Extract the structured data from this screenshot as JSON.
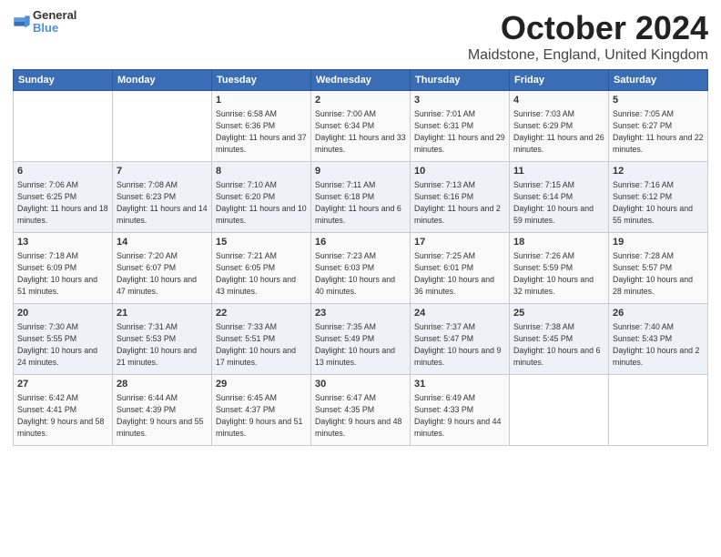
{
  "logo": {
    "line1": "General",
    "line2": "Blue"
  },
  "title": "October 2024",
  "subtitle": "Maidstone, England, United Kingdom",
  "days_of_week": [
    "Sunday",
    "Monday",
    "Tuesday",
    "Wednesday",
    "Thursday",
    "Friday",
    "Saturday"
  ],
  "weeks": [
    [
      {
        "day": "",
        "info": ""
      },
      {
        "day": "",
        "info": ""
      },
      {
        "day": "1",
        "info": "Sunrise: 6:58 AM\nSunset: 6:36 PM\nDaylight: 11 hours and 37 minutes."
      },
      {
        "day": "2",
        "info": "Sunrise: 7:00 AM\nSunset: 6:34 PM\nDaylight: 11 hours and 33 minutes."
      },
      {
        "day": "3",
        "info": "Sunrise: 7:01 AM\nSunset: 6:31 PM\nDaylight: 11 hours and 29 minutes."
      },
      {
        "day": "4",
        "info": "Sunrise: 7:03 AM\nSunset: 6:29 PM\nDaylight: 11 hours and 26 minutes."
      },
      {
        "day": "5",
        "info": "Sunrise: 7:05 AM\nSunset: 6:27 PM\nDaylight: 11 hours and 22 minutes."
      }
    ],
    [
      {
        "day": "6",
        "info": "Sunrise: 7:06 AM\nSunset: 6:25 PM\nDaylight: 11 hours and 18 minutes."
      },
      {
        "day": "7",
        "info": "Sunrise: 7:08 AM\nSunset: 6:23 PM\nDaylight: 11 hours and 14 minutes."
      },
      {
        "day": "8",
        "info": "Sunrise: 7:10 AM\nSunset: 6:20 PM\nDaylight: 11 hours and 10 minutes."
      },
      {
        "day": "9",
        "info": "Sunrise: 7:11 AM\nSunset: 6:18 PM\nDaylight: 11 hours and 6 minutes."
      },
      {
        "day": "10",
        "info": "Sunrise: 7:13 AM\nSunset: 6:16 PM\nDaylight: 11 hours and 2 minutes."
      },
      {
        "day": "11",
        "info": "Sunrise: 7:15 AM\nSunset: 6:14 PM\nDaylight: 10 hours and 59 minutes."
      },
      {
        "day": "12",
        "info": "Sunrise: 7:16 AM\nSunset: 6:12 PM\nDaylight: 10 hours and 55 minutes."
      }
    ],
    [
      {
        "day": "13",
        "info": "Sunrise: 7:18 AM\nSunset: 6:09 PM\nDaylight: 10 hours and 51 minutes."
      },
      {
        "day": "14",
        "info": "Sunrise: 7:20 AM\nSunset: 6:07 PM\nDaylight: 10 hours and 47 minutes."
      },
      {
        "day": "15",
        "info": "Sunrise: 7:21 AM\nSunset: 6:05 PM\nDaylight: 10 hours and 43 minutes."
      },
      {
        "day": "16",
        "info": "Sunrise: 7:23 AM\nSunset: 6:03 PM\nDaylight: 10 hours and 40 minutes."
      },
      {
        "day": "17",
        "info": "Sunrise: 7:25 AM\nSunset: 6:01 PM\nDaylight: 10 hours and 36 minutes."
      },
      {
        "day": "18",
        "info": "Sunrise: 7:26 AM\nSunset: 5:59 PM\nDaylight: 10 hours and 32 minutes."
      },
      {
        "day": "19",
        "info": "Sunrise: 7:28 AM\nSunset: 5:57 PM\nDaylight: 10 hours and 28 minutes."
      }
    ],
    [
      {
        "day": "20",
        "info": "Sunrise: 7:30 AM\nSunset: 5:55 PM\nDaylight: 10 hours and 24 minutes."
      },
      {
        "day": "21",
        "info": "Sunrise: 7:31 AM\nSunset: 5:53 PM\nDaylight: 10 hours and 21 minutes."
      },
      {
        "day": "22",
        "info": "Sunrise: 7:33 AM\nSunset: 5:51 PM\nDaylight: 10 hours and 17 minutes."
      },
      {
        "day": "23",
        "info": "Sunrise: 7:35 AM\nSunset: 5:49 PM\nDaylight: 10 hours and 13 minutes."
      },
      {
        "day": "24",
        "info": "Sunrise: 7:37 AM\nSunset: 5:47 PM\nDaylight: 10 hours and 9 minutes."
      },
      {
        "day": "25",
        "info": "Sunrise: 7:38 AM\nSunset: 5:45 PM\nDaylight: 10 hours and 6 minutes."
      },
      {
        "day": "26",
        "info": "Sunrise: 7:40 AM\nSunset: 5:43 PM\nDaylight: 10 hours and 2 minutes."
      }
    ],
    [
      {
        "day": "27",
        "info": "Sunrise: 6:42 AM\nSunset: 4:41 PM\nDaylight: 9 hours and 58 minutes."
      },
      {
        "day": "28",
        "info": "Sunrise: 6:44 AM\nSunset: 4:39 PM\nDaylight: 9 hours and 55 minutes."
      },
      {
        "day": "29",
        "info": "Sunrise: 6:45 AM\nSunset: 4:37 PM\nDaylight: 9 hours and 51 minutes."
      },
      {
        "day": "30",
        "info": "Sunrise: 6:47 AM\nSunset: 4:35 PM\nDaylight: 9 hours and 48 minutes."
      },
      {
        "day": "31",
        "info": "Sunrise: 6:49 AM\nSunset: 4:33 PM\nDaylight: 9 hours and 44 minutes."
      },
      {
        "day": "",
        "info": ""
      },
      {
        "day": "",
        "info": ""
      }
    ]
  ]
}
